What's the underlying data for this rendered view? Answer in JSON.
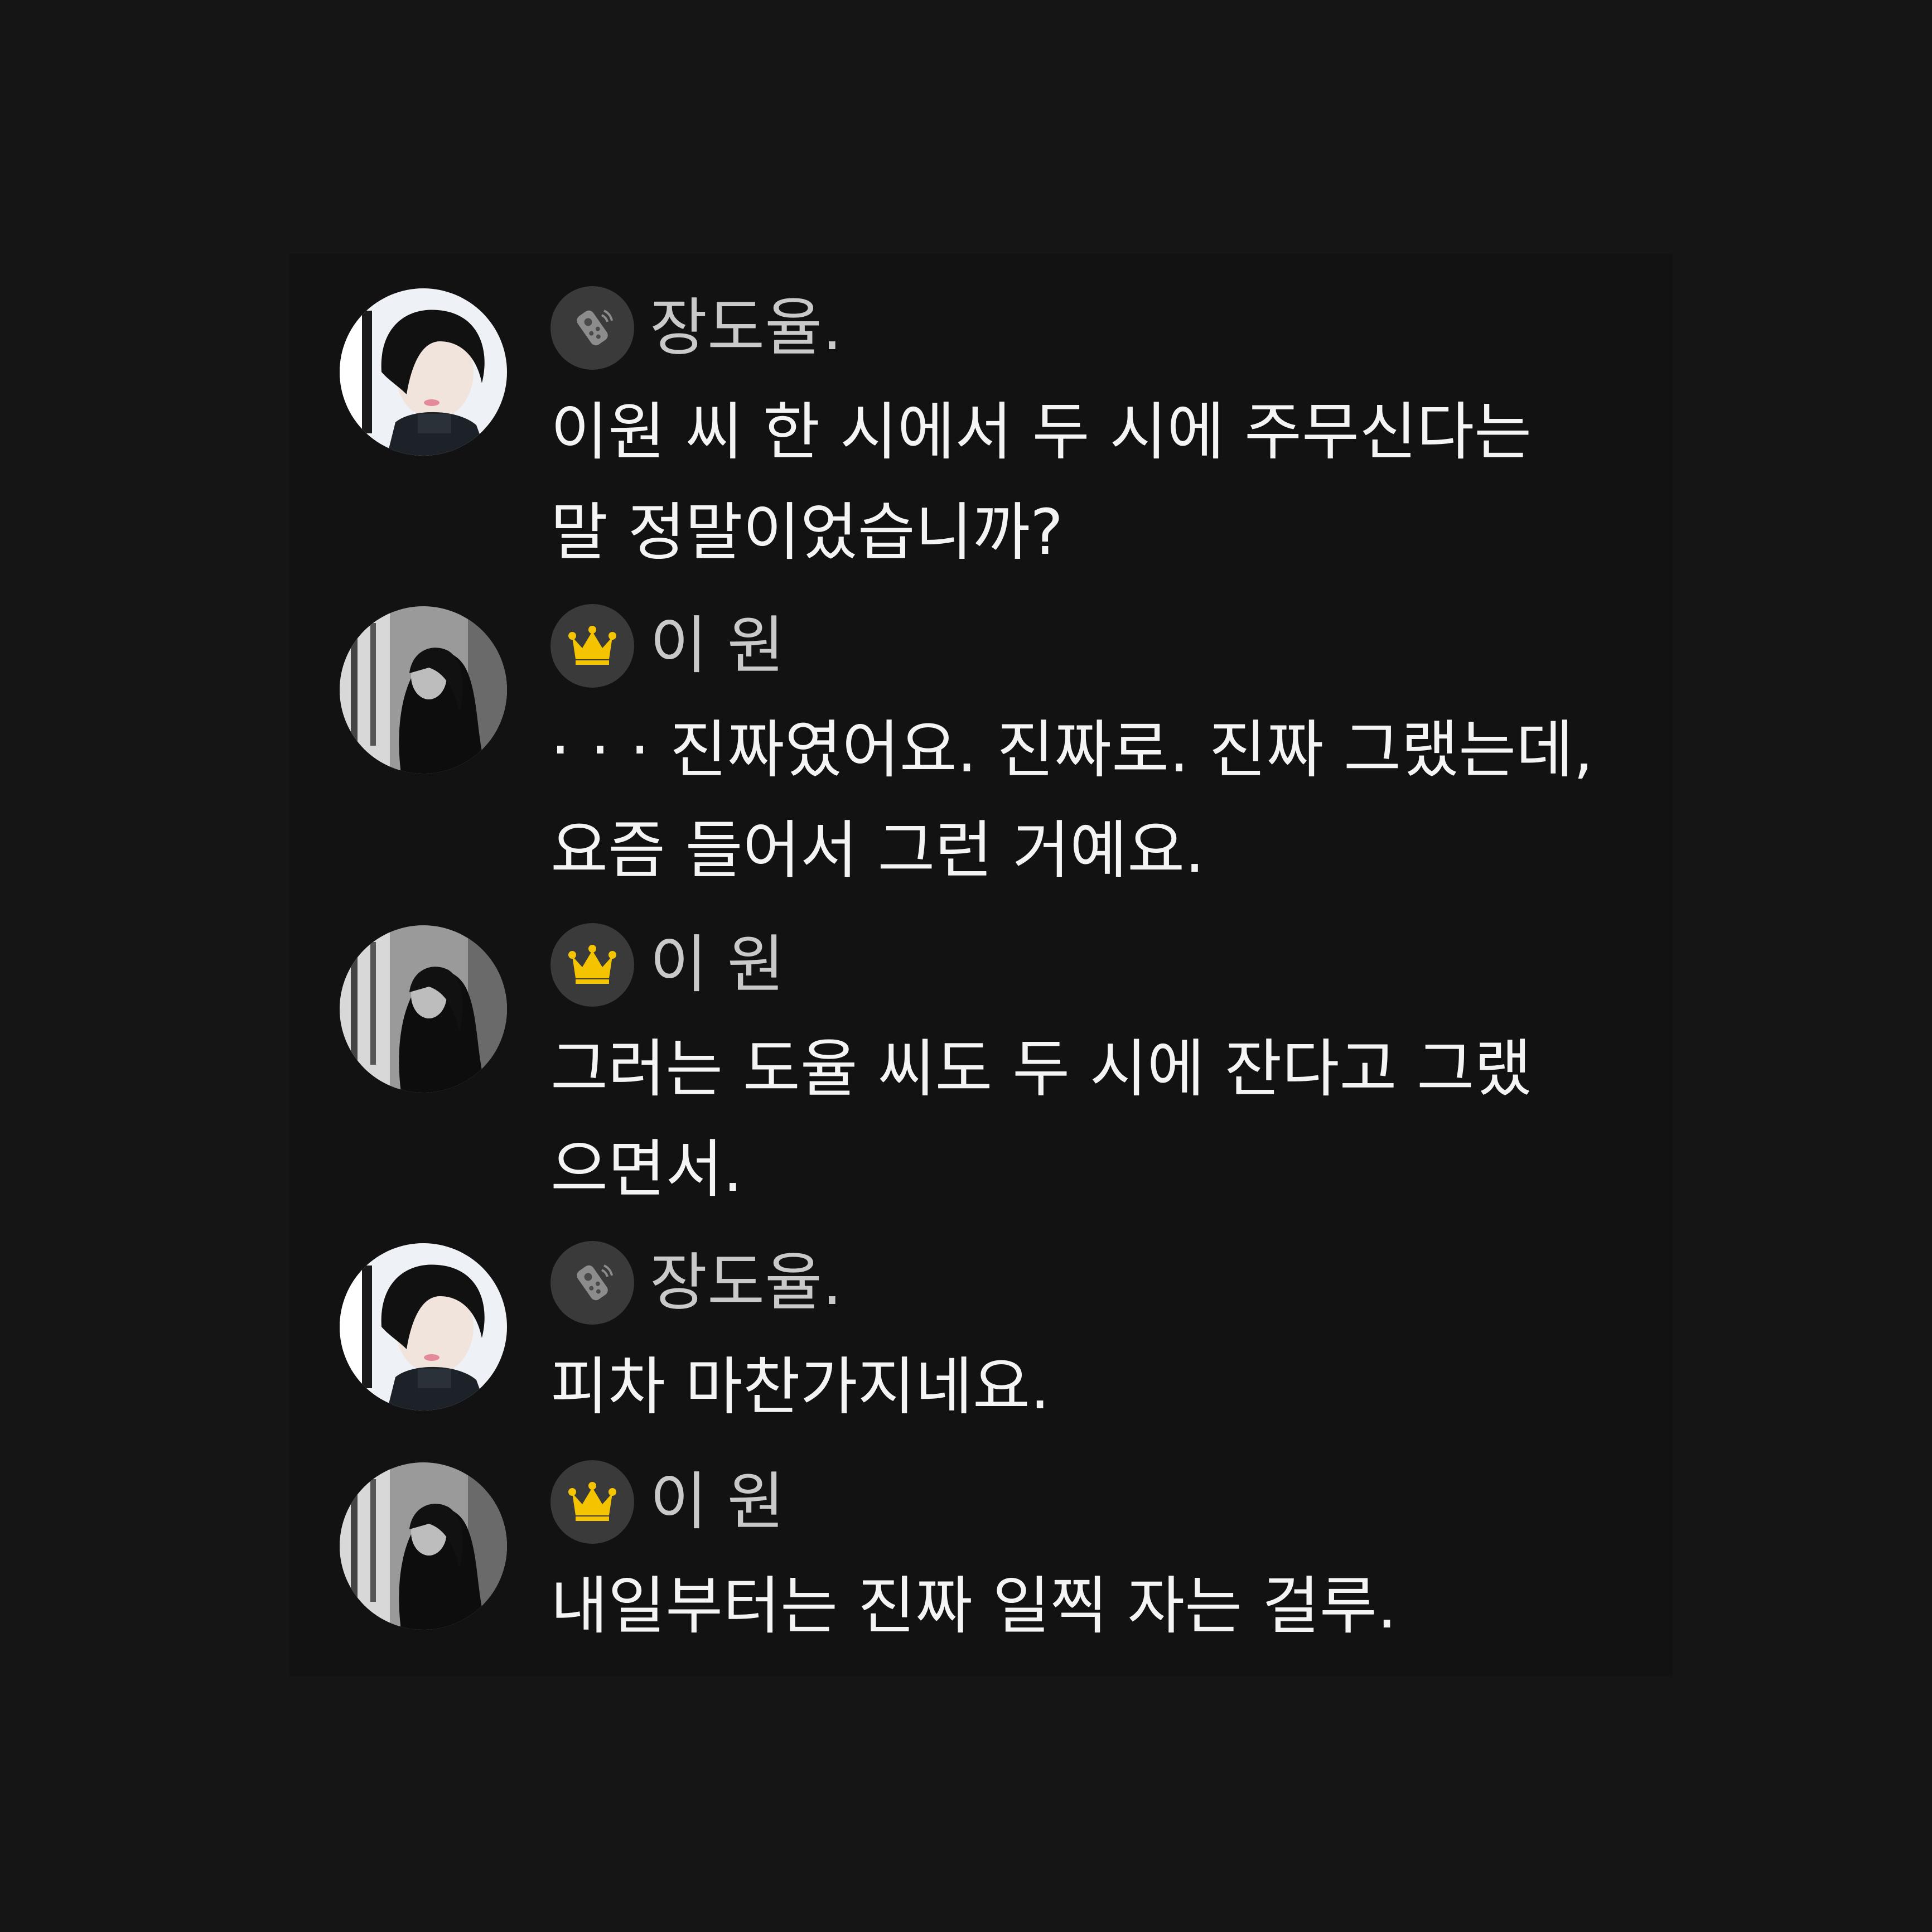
{
  "messages": [
    {
      "sender": "장도율.",
      "badge_icon": "remote-control-icon",
      "avatar": "man-portrait-avatar",
      "lines": [
        "이원 씨 한 시에서 두 시에 주무신다는",
        "말 정말이었습니까?"
      ]
    },
    {
      "sender": "이 원",
      "badge_icon": "crown-icon",
      "avatar": "woman-monochrome-avatar",
      "lines": [
        "· · · 진짜였어요. 진짜로. 진짜 그랬는데,",
        "요즘 들어서 그런 거예요."
      ]
    },
    {
      "sender": "이 원",
      "badge_icon": "crown-icon",
      "avatar": "woman-monochrome-avatar",
      "lines": [
        "그러는 도율 씨도 두 시에 잔다고 그랬",
        "으면서."
      ]
    },
    {
      "sender": "장도율.",
      "badge_icon": "remote-control-icon",
      "avatar": "man-portrait-avatar",
      "lines": [
        "피차 마찬가지네요."
      ]
    },
    {
      "sender": "이 원",
      "badge_icon": "crown-icon",
      "avatar": "woman-monochrome-avatar",
      "lines": [
        "내일부터는 진짜 일찍 자는 걸루."
      ]
    }
  ],
  "colors": {
    "background": "#151515",
    "panel": "#121212",
    "badge_bg": "#3a3a3a",
    "crown": "#f5c400",
    "name_text": "#c9c9c9",
    "message_text": "#f4f4f4"
  }
}
